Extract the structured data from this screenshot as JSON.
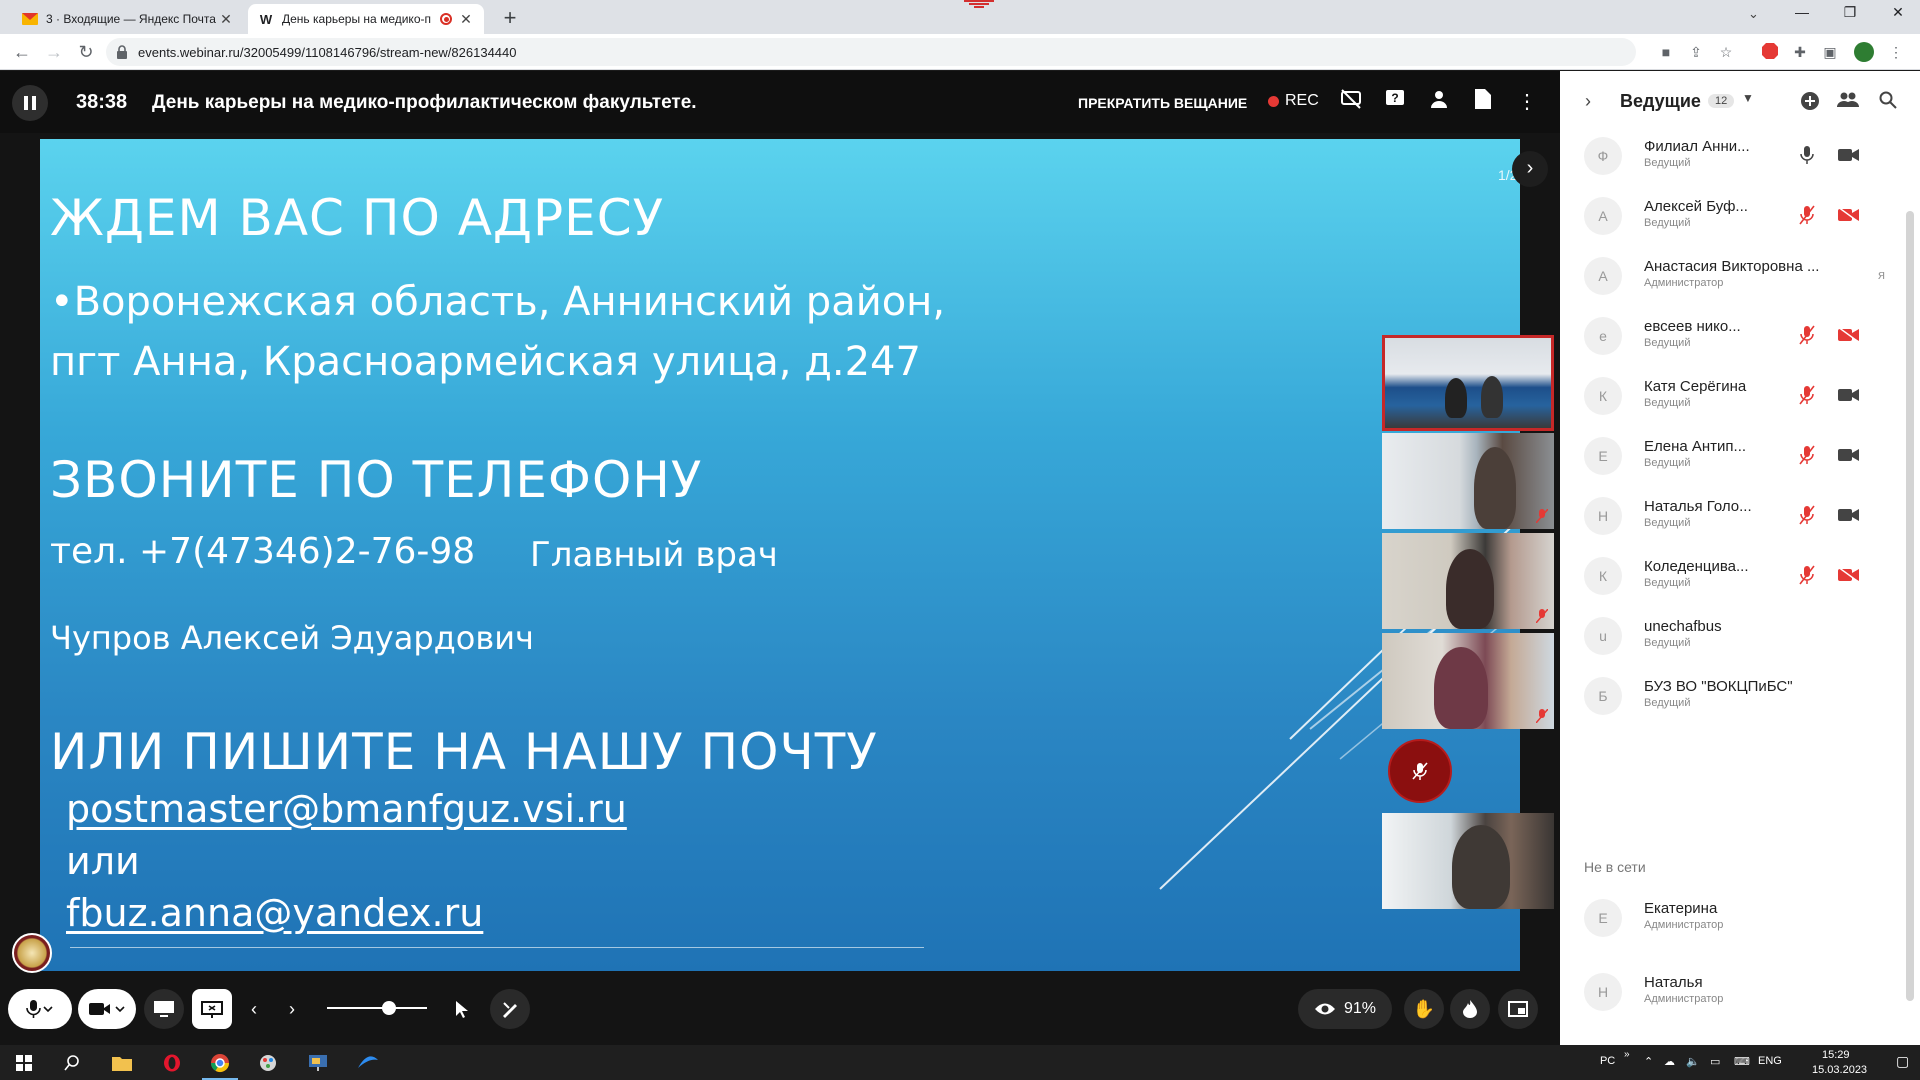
{
  "browser": {
    "tabs": [
      {
        "title": "3 · Входящие — Яндекс Почта",
        "favicon": "mail-icon",
        "active": false
      },
      {
        "title": "День карьеры на медико-п",
        "favicon": "webinar-w-icon",
        "active": true
      }
    ],
    "new_tab": "+",
    "url": "events.webinar.ru/32005499/1108146796/stream-new/826134440",
    "window_controls": [
      "minimize",
      "restore",
      "close"
    ]
  },
  "topbar": {
    "timer": "38:38",
    "title": "День карьеры на медико-профилактическом факультете.",
    "stop_label": "ПРЕКРАТИТЬ ВЕЩАНИЕ",
    "rec_label": "REC"
  },
  "slide": {
    "heading1": "ЖДЕМ ВАС ПО АДРЕСУ",
    "address_line1": "•Воронежская область, Аннинский район,",
    "address_line2": "пгт Анна, Красноармейская улица, д.247",
    "heading2": "ЗВОНИТЕ ПО ТЕЛЕФОНУ",
    "phone": "тел. +7(47346)2-76-98",
    "doctor_title": "Главный врач",
    "doctor_name": "Чупров Алексей Эдуардович",
    "heading3": "ИЛИ ПИШИТЕ НА НАШУ ПОЧТУ",
    "email1": "postmaster@bmanfguz.vsi.ru",
    "or": "или",
    "email2": "fbuz.anna@yandex.ru",
    "page_indicator": "1/2",
    "background_colors": [
      "#5bd3ee",
      "#1f73b5"
    ]
  },
  "controls": {
    "viewers_percent": "91%"
  },
  "panel": {
    "title": "Ведущие",
    "count": "12",
    "participants": [
      {
        "initial": "Ф",
        "name": "Филиал Анни...",
        "role": "Ведущий",
        "mic": "on",
        "cam": "on"
      },
      {
        "initial": "А",
        "name": "Алексей Буф...",
        "role": "Ведущий",
        "mic": "off",
        "cam": "off"
      },
      {
        "initial": "А",
        "name": "Анастасия Викторовна ...",
        "role": "Администратор",
        "mic": "none",
        "cam": "none",
        "extra": "я"
      },
      {
        "initial": "е",
        "name": "евсеев нико...",
        "role": "Ведущий",
        "mic": "off",
        "cam": "off"
      },
      {
        "initial": "К",
        "name": "Катя Серёгина",
        "role": "Ведущий",
        "mic": "off",
        "cam": "on"
      },
      {
        "initial": "Е",
        "name": "Елена Антип...",
        "role": "Ведущий",
        "mic": "off",
        "cam": "on"
      },
      {
        "initial": "Н",
        "name": "Наталья Голо...",
        "role": "Ведущий",
        "mic": "off",
        "cam": "on"
      },
      {
        "initial": "К",
        "name": "Коледенцива...",
        "role": "Ведущий",
        "mic": "off",
        "cam": "off"
      },
      {
        "initial": "u",
        "name": "unechafbus",
        "role": "Ведущий",
        "mic": "none",
        "cam": "none"
      },
      {
        "initial": "Б",
        "name": "БУЗ ВО \"ВОКЦПиБС\"",
        "role": "Ведущий",
        "mic": "none",
        "cam": "none"
      }
    ],
    "offline_label": "Не в сети",
    "offline": [
      {
        "initial": "Е",
        "name": "Екатерина",
        "role": "Администратор"
      },
      {
        "initial": "Н",
        "name": "Наталья",
        "role": "Администратор"
      }
    ]
  },
  "taskbar": {
    "lang_short": "РС",
    "lang": "ENG",
    "time": "15:29",
    "date": "15.03.2023"
  },
  "colors": {
    "accent_red": "#e53935",
    "panel_bg": "#ffffff",
    "topbar_bg": "#0f0f0f"
  }
}
